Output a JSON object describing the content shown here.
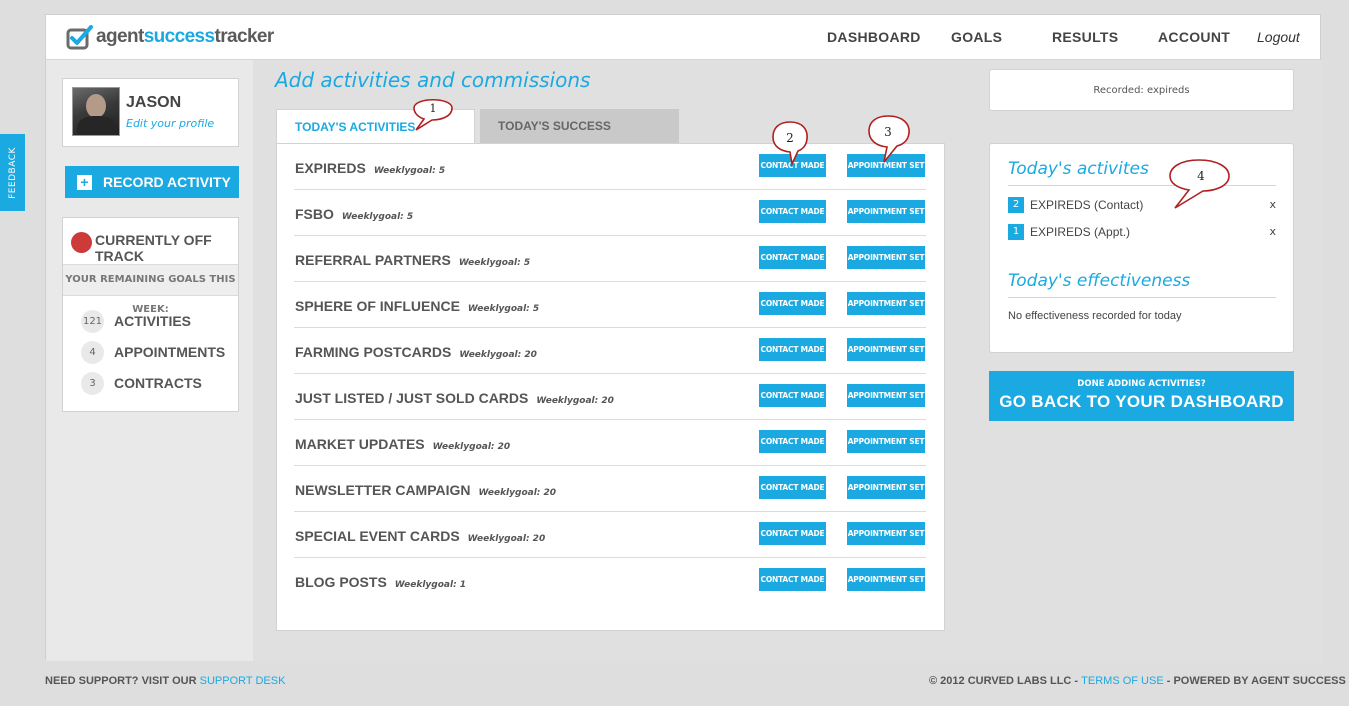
{
  "header": {
    "logo_plain": "agent",
    "logo_highlight": "success",
    "logo_end": "tracker",
    "nav": [
      "DASHBOARD",
      "GOALS",
      "RESULTS",
      "ACCOUNT"
    ],
    "logout": "Logout"
  },
  "feedback_label": "FEEDBACK",
  "profile": {
    "name": "JASON",
    "edit_link": "Edit your profile"
  },
  "record_activity": {
    "icon": "+",
    "label": "RECORD ACTIVITY"
  },
  "track_status": {
    "title": "CURRENTLY OFF TRACK",
    "subtitle": "YOUR REMAINING GOALS THIS WEEK:",
    "goals": [
      {
        "count": "121",
        "label": "ACTIVITIES"
      },
      {
        "count": "4",
        "label": "APPOINTMENTS"
      },
      {
        "count": "3",
        "label": "CONTRACTS"
      }
    ]
  },
  "main": {
    "heading": "Add activities and commissions",
    "tabs": [
      "TODAY'S ACTIVITIES",
      "TODAY'S SUCCESS"
    ],
    "contact_label": "CONTACT MADE",
    "appt_label": "APPOINTMENT SET",
    "activities": [
      {
        "name": "EXPIREDS",
        "goal": "Weeklygoal: 5"
      },
      {
        "name": "FSBO",
        "goal": "Weeklygoal: 5"
      },
      {
        "name": "REFERRAL PARTNERS",
        "goal": "Weeklygoal: 5"
      },
      {
        "name": "SPHERE OF INFLUENCE",
        "goal": "Weeklygoal: 5"
      },
      {
        "name": "FARMING POSTCARDS",
        "goal": "Weeklygoal: 20"
      },
      {
        "name": "JUST LISTED / JUST SOLD CARDS",
        "goal": "Weeklygoal: 20"
      },
      {
        "name": "MARKET UPDATES",
        "goal": "Weeklygoal: 20"
      },
      {
        "name": "NEWSLETTER CAMPAIGN",
        "goal": "Weeklygoal: 20"
      },
      {
        "name": "SPECIAL EVENT CARDS",
        "goal": "Weeklygoal: 20"
      },
      {
        "name": "BLOG POSTS",
        "goal": "Weeklygoal: 1"
      }
    ]
  },
  "right": {
    "recorded": "Recorded: expireds",
    "todays_activities_title": "Today's activites",
    "todays_activities": [
      {
        "count": "2",
        "label": "EXPIREDS (Contact)",
        "remove": "x"
      },
      {
        "count": "1",
        "label": "EXPIREDS (Appt.)",
        "remove": "x"
      }
    ],
    "effectiveness_title": "Today's effectiveness",
    "effectiveness_empty": "No effectiveness recorded for today",
    "done_small": "DONE ADDING ACTIVITIES?",
    "done_big": "GO BACK TO YOUR DASHBOARD"
  },
  "callouts": [
    "1",
    "2",
    "3",
    "4"
  ],
  "footer": {
    "support_prefix": "NEED SUPPORT? VISIT OUR",
    "support_link": "SUPPORT DESK",
    "copyright": "© 2012 CURVED LABS LLC -",
    "terms": "TERMS OF USE",
    "powered": "- POWERED BY AGENT SUCCESS TRACKER"
  },
  "colors": {
    "accent": "#1ba9e1",
    "off_track": "#cc3a3a"
  }
}
